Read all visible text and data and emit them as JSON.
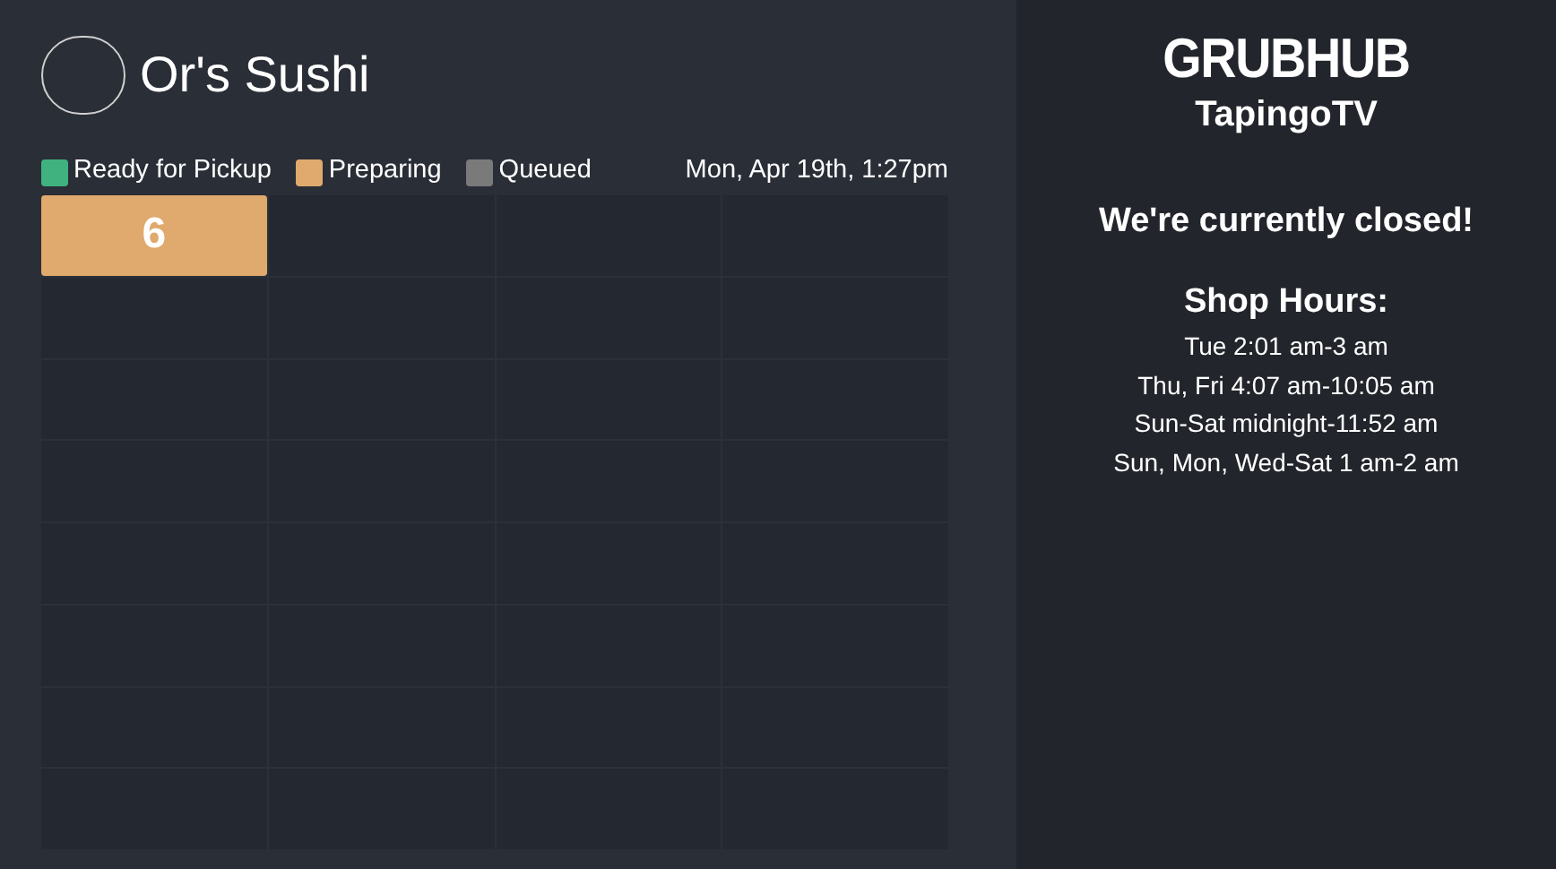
{
  "header": {
    "restaurant_name": "Or's Sushi"
  },
  "legend": [
    {
      "label": "Ready for Pickup",
      "color": "#3fb27f"
    },
    {
      "label": "Preparing",
      "color": "#e0a96d"
    },
    {
      "label": "Queued",
      "color": "#7a7a7a"
    }
  ],
  "datetime": "Mon, Apr 19th, 1:27pm",
  "orders": [
    {
      "number": "6",
      "kind": "preparing"
    }
  ],
  "side_panel": {
    "logo": "GRUBHUB",
    "subtitle": "TapingoTV",
    "message": "We're currently closed!",
    "hours_title": "Shop Hours:",
    "hours": [
      "Tue 2:01 am-3 am",
      "Thu, Fri 4:07 am-10:05 am",
      "Sun-Sat midnight-11:52 am",
      "Sun, Mon, Wed-Sat 1 am-2 am"
    ]
  }
}
